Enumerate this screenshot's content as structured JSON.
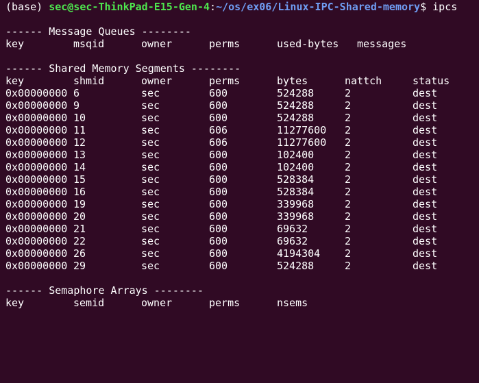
{
  "prompt": {
    "env": "(base)",
    "user_host": "sec@sec-ThinkPad-E15-Gen-4",
    "separator": ":",
    "path": "~/os/ex06/Linux-IPC-Shared-memory",
    "symbol": "$",
    "command": "ipcs"
  },
  "message_queues": {
    "heading": "------ Message Queues --------",
    "columns": [
      "key",
      "msqid",
      "owner",
      "perms",
      "used-bytes",
      "messages"
    ]
  },
  "shared_memory": {
    "heading": "------ Shared Memory Segments --------",
    "columns": [
      "key",
      "shmid",
      "owner",
      "perms",
      "bytes",
      "nattch",
      "status"
    ],
    "rows": [
      [
        "0x00000000",
        "6",
        "sec",
        "600",
        "524288",
        "2",
        "dest"
      ],
      [
        "0x00000000",
        "9",
        "sec",
        "600",
        "524288",
        "2",
        "dest"
      ],
      [
        "0x00000000",
        "10",
        "sec",
        "600",
        "524288",
        "2",
        "dest"
      ],
      [
        "0x00000000",
        "11",
        "sec",
        "606",
        "11277600",
        "2",
        "dest"
      ],
      [
        "0x00000000",
        "12",
        "sec",
        "606",
        "11277600",
        "2",
        "dest"
      ],
      [
        "0x00000000",
        "13",
        "sec",
        "600",
        "102400",
        "2",
        "dest"
      ],
      [
        "0x00000000",
        "14",
        "sec",
        "600",
        "102400",
        "2",
        "dest"
      ],
      [
        "0x00000000",
        "15",
        "sec",
        "600",
        "528384",
        "2",
        "dest"
      ],
      [
        "0x00000000",
        "16",
        "sec",
        "600",
        "528384",
        "2",
        "dest"
      ],
      [
        "0x00000000",
        "19",
        "sec",
        "600",
        "339968",
        "2",
        "dest"
      ],
      [
        "0x00000000",
        "20",
        "sec",
        "600",
        "339968",
        "2",
        "dest"
      ],
      [
        "0x00000000",
        "21",
        "sec",
        "600",
        "69632",
        "2",
        "dest"
      ],
      [
        "0x00000000",
        "22",
        "sec",
        "600",
        "69632",
        "2",
        "dest"
      ],
      [
        "0x00000000",
        "26",
        "sec",
        "600",
        "4194304",
        "2",
        "dest"
      ],
      [
        "0x00000000",
        "29",
        "sec",
        "600",
        "524288",
        "2",
        "dest"
      ]
    ]
  },
  "semaphores": {
    "heading": "------ Semaphore Arrays --------",
    "columns": [
      "key",
      "semid",
      "owner",
      "perms",
      "nsems"
    ]
  },
  "colors": {
    "background": "#300a24",
    "text": "#ffffff",
    "user_host": "#4ee64e",
    "path": "#6f9cf2"
  }
}
